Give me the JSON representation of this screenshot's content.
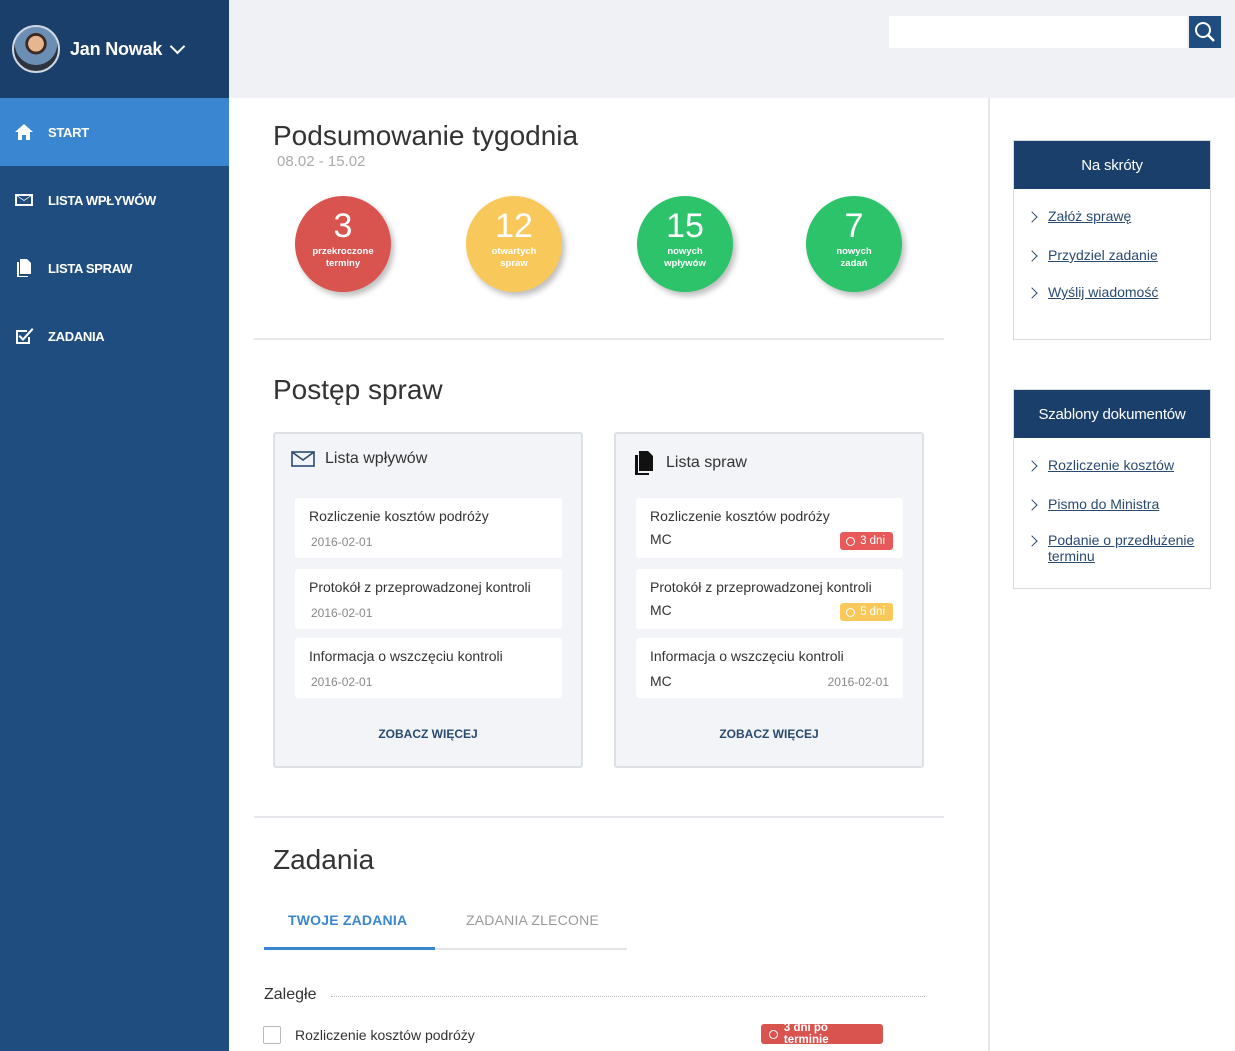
{
  "user": {
    "name": "Jan Nowak"
  },
  "nav": [
    {
      "label": "START",
      "icon": "home-icon",
      "active": true
    },
    {
      "label": "LISTA WPŁYWÓW",
      "icon": "envelope-icon",
      "active": false
    },
    {
      "label": "LISTA SPRAW",
      "icon": "documents-icon",
      "active": false
    },
    {
      "label": "ZADANIA",
      "icon": "checkbox-icon",
      "active": false
    }
  ],
  "search": {
    "placeholder": ""
  },
  "summary": {
    "title": "Podsumowanie tygodnia",
    "date_range": "08.02 - 15.02",
    "stats": [
      {
        "value": "3",
        "label1": "przekroczone",
        "label2": "terminy",
        "color": "#d9534f"
      },
      {
        "value": "12",
        "label1": "otwartych",
        "label2": "spraw",
        "color": "#f9c85a"
      },
      {
        "value": "15",
        "label1": "nowych",
        "label2": "wpływów",
        "color": "#2cc36b"
      },
      {
        "value": "7",
        "label1": "nowych",
        "label2": "zadań",
        "color": "#2cc36b"
      }
    ]
  },
  "progress": {
    "title": "Postęp spraw",
    "inflows": {
      "title": "Lista wpływów",
      "items": [
        {
          "title": "Rozliczenie kosztów podróży",
          "date": "2016-02-01"
        },
        {
          "title": "Protokół z przeprowadzonej kontroli",
          "date": "2016-02-01"
        },
        {
          "title": "Informacja o wszczęciu kontroli",
          "date": "2016-02-01"
        }
      ],
      "see_more": "ZOBACZ WIĘCEJ"
    },
    "cases": {
      "title": "Lista spraw",
      "items": [
        {
          "title": "Rozliczenie kosztów podróży",
          "owner": "MC",
          "badge": "3 dni",
          "badge_color": "#e85a5a"
        },
        {
          "title": "Protokół z przeprowadzonej kontroli",
          "owner": "MC",
          "badge": "5 dni",
          "badge_color": "#f9c85a"
        },
        {
          "title": "Informacja o wszczęciu kontroli",
          "owner": "MC",
          "date": "2016-02-01"
        }
      ],
      "see_more": "ZOBACZ WIĘCEJ"
    }
  },
  "tasks": {
    "title": "Zadania",
    "tabs": [
      {
        "label": "TWOJE ZADANIA",
        "active": true
      },
      {
        "label": "ZADANIA ZLECONE",
        "active": false
      }
    ],
    "overdue_label": "Zaległe",
    "items": [
      {
        "title": "Rozliczenie kosztów podróży",
        "badge": "3 dni po terminie"
      }
    ]
  },
  "shortcuts": {
    "title": "Na skróty",
    "links": [
      "Załóż sprawę",
      "Przydziel zadanie",
      "Wyślij wiadomość"
    ]
  },
  "templates": {
    "title": "Szablony dokumentów",
    "links": [
      "Rozliczenie kosztów",
      "Pismo do Ministra",
      "Podanie o przedłużenie terminu"
    ]
  },
  "colors": {
    "sidebar": "#1f4d7f",
    "accent": "#3a86d0",
    "header_dark": "#1a3f6a"
  }
}
